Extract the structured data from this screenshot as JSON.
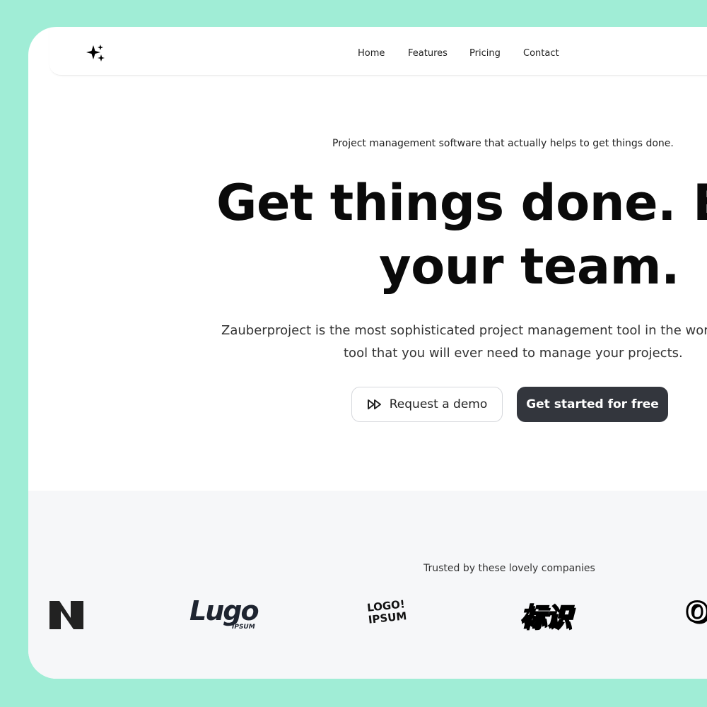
{
  "nav": {
    "logo_icon": "sparkles-icon",
    "links": [
      "Home",
      "Features",
      "Pricing",
      "Contact"
    ]
  },
  "hero": {
    "subtitle": "Project management software that actually helps to get things done.",
    "heading_line1": "Get things done. Elev",
    "heading_line2": "your team.",
    "description_line1": "Zauberproject is the most sophisticated project management tool in the worl",
    "description_line2": "tool that you will ever need to manage your projects.",
    "demo_button": "Request a demo",
    "demo_icon": "fast-forward-icon",
    "start_button": "Get started for free"
  },
  "trusted": {
    "title": "Trusted by these lovely companies",
    "logos": [
      "N",
      "Logo IPSUM",
      "LOGO! IPSUM",
      "标识",
      "O"
    ]
  },
  "colors": {
    "background": "#a0edd6",
    "primary_button": "#33363d",
    "section_gray": "#f6f7f9"
  }
}
